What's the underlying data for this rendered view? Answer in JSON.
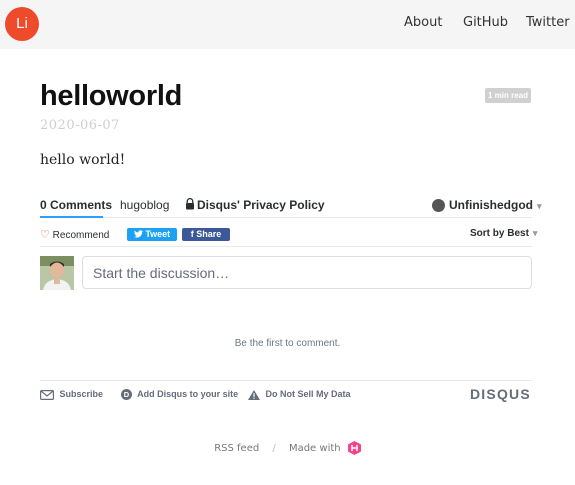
{
  "header": {
    "logo": "Li",
    "nav": [
      "About",
      "GitHub",
      "Twitter"
    ]
  },
  "post": {
    "title": "helloworld",
    "read_time": "1 min read",
    "date": "2020-06-07",
    "body": "hello world!"
  },
  "disqus": {
    "tabs": {
      "comments": "0 Comments",
      "forum": "hugoblog",
      "privacy": "Disqus' Privacy Policy"
    },
    "user": "Unfinishedgod",
    "recommend": "Recommend",
    "tweet": "Tweet",
    "share": "Share",
    "sort": "Sort by Best",
    "comment_placeholder": "Start the discussion…",
    "empty_note": "Be the first to comment.",
    "footer": {
      "subscribe": "Subscribe",
      "add": "Add Disqus to your site",
      "dnsmpi": "Do Not Sell My Data",
      "brand": "DISQUS"
    },
    "colors": {
      "accent": "#2e9fff",
      "twitter": "#1da1f2",
      "facebook": "#3b5998",
      "heart": "#e74c3c"
    }
  },
  "site_footer": {
    "rss": "RSS feed",
    "separator": "/",
    "made_with": "Made with"
  },
  "colors": {
    "logo_bg": "#ee4b2b",
    "hugo_icon": "#ff4088"
  }
}
